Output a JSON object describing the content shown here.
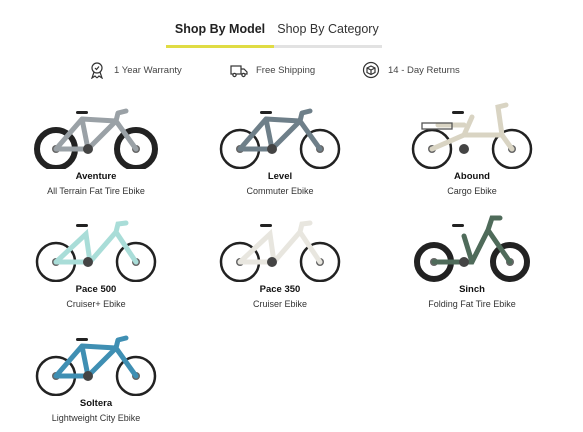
{
  "tabs": [
    {
      "label": "Shop By Model",
      "active": true
    },
    {
      "label": "Shop By Category",
      "active": false
    }
  ],
  "benefits": [
    {
      "icon": "award-ribbon-icon",
      "label": "1 Year Warranty"
    },
    {
      "icon": "delivery-truck-icon",
      "label": "Free Shipping"
    },
    {
      "icon": "return-box-icon",
      "label": "14 - Day Returns"
    }
  ],
  "products": [
    {
      "name": "Aventure",
      "category": "All Terrain Fat Tire Ebike",
      "color": "#9aa1a6"
    },
    {
      "name": "Level",
      "category": "Commuter Ebike",
      "color": "#6e7f89"
    },
    {
      "name": "Abound",
      "category": "Cargo Ebike",
      "color": "#d9d4c3"
    },
    {
      "name": "Pace 500",
      "category": "Cruiser+ Ebike",
      "color": "#a9ddd8"
    },
    {
      "name": "Pace 350",
      "category": "Cruiser Ebike",
      "color": "#e8e6df"
    },
    {
      "name": "Sinch",
      "category": "Folding Fat Tire Ebike",
      "color": "#4f6b5a"
    },
    {
      "name": "Soltera",
      "category": "Lightweight City Ebike",
      "color": "#3f8fb3"
    }
  ],
  "colors": {
    "accent": "#e0dc44",
    "inactive_line": "#e2e2e2"
  }
}
